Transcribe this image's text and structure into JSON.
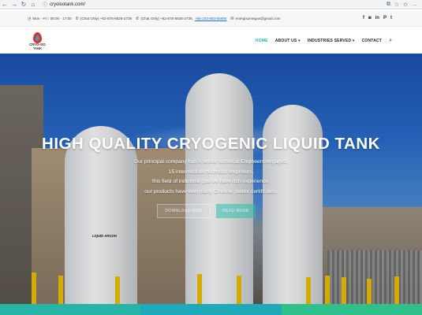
{
  "browser": {
    "url": "cryoisotank.com/",
    "back": "←",
    "forward": "→",
    "reload": "↻",
    "home": "⌂",
    "lock": "ⓘ"
  },
  "topbar": {
    "hours": "Mon - Fri : 08:00 - 17:00",
    "phone_chat1": "(Chat Only) +62-878-8826-2739",
    "phone_chat2": "(Chat Only) +62-878-8826-2739",
    "phone_extra": "+86-153-863-65990",
    "email": "energisurvegas@gmail.com"
  },
  "social_icons": [
    "f",
    "◙",
    "in",
    "P",
    "t"
  ],
  "logo": {
    "line1": "CRYO-ISO",
    "line2": "TANK"
  },
  "menu": {
    "home": "HOME",
    "about": "ABOUT US ▾",
    "industries": "INDUSTRIES SERVED ▾",
    "contact": "CONTACT"
  },
  "hero": {
    "title": "HIGH QUALITY CRYOGENIC LIQUID TANK",
    "lines": [
      "Our principal company has 6 senior technical Engineers engaged,",
      "15 intermediate technical engineers,",
      "this field of industrial gas we have rich experience,",
      "our products have won many Chinese patent certificates."
    ],
    "btn_download": "DOWNLOAD NOW",
    "btn_more": "READ MORE",
    "tank_label": "LIQUID ARGON"
  },
  "colors": {
    "accent": "#25b5a4",
    "footer_strip": [
      "#27b3a6",
      "#1fa9b9",
      "#2fc08c"
    ]
  }
}
